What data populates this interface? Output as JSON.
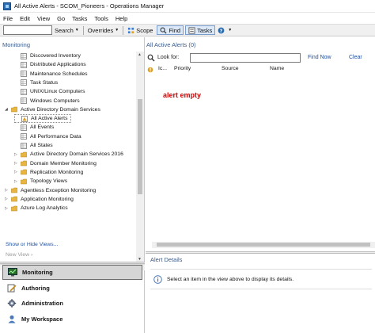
{
  "window": {
    "title": "All Active Alerts - SCOM_Pioneers - Operations Manager"
  },
  "menu": [
    "File",
    "Edit",
    "View",
    "Go",
    "Tasks",
    "Tools",
    "Help"
  ],
  "toolbar": {
    "search_label": "Search",
    "search_value": "",
    "overrides_label": "Overrides",
    "scope_label": "Scope",
    "find_label": "Find",
    "tasks_label": "Tasks"
  },
  "left": {
    "header": "Monitoring",
    "tree": [
      {
        "label": "Discovered Inventory",
        "level": 1,
        "icon": "grid"
      },
      {
        "label": "Distributed Applications",
        "level": 1,
        "icon": "grid"
      },
      {
        "label": "Maintenance Schedules",
        "level": 1,
        "icon": "grid"
      },
      {
        "label": "Task Status",
        "level": 1,
        "icon": "grid"
      },
      {
        "label": "UNIX/Linux Computers",
        "level": 1,
        "icon": "grid"
      },
      {
        "label": "Windows Computers",
        "level": 1,
        "icon": "grid"
      },
      {
        "label": "Active Directory Domain Services",
        "level": 0,
        "icon": "folder",
        "expanded": true
      },
      {
        "label": "All Active Alerts",
        "level": 1,
        "icon": "alert",
        "selected": true
      },
      {
        "label": "All Events",
        "level": 1,
        "icon": "grid"
      },
      {
        "label": "All Performance Data",
        "level": 1,
        "icon": "grid"
      },
      {
        "label": "All States",
        "level": 1,
        "icon": "grid"
      },
      {
        "label": "Active Directory Domain Services 2016",
        "level": 1,
        "icon": "folder",
        "expanded": false
      },
      {
        "label": "Domain Member Monitoring",
        "level": 1,
        "icon": "folder",
        "expanded": false
      },
      {
        "label": "Replication Monitoring",
        "level": 1,
        "icon": "folder",
        "expanded": false
      },
      {
        "label": "Topology Views",
        "level": 1,
        "icon": "folder",
        "expanded": false
      },
      {
        "label": "Agentless Exception Monitoring",
        "level": 0,
        "icon": "folder",
        "expanded": false
      },
      {
        "label": "Application Monitoring",
        "level": 0,
        "icon": "folder",
        "expanded": false
      },
      {
        "label": "Azure Log Analytics",
        "level": 0,
        "icon": "folder",
        "expanded": false
      }
    ],
    "show_hide_views": "Show or Hide Views...",
    "new_view": "New View ›",
    "workspaces": [
      {
        "label": "Monitoring",
        "icon": "monitor-icon",
        "active": true
      },
      {
        "label": "Authoring",
        "icon": "authoring-icon",
        "active": false
      },
      {
        "label": "Administration",
        "icon": "gear-icon",
        "active": false
      },
      {
        "label": "My Workspace",
        "icon": "user-icon",
        "active": false
      }
    ]
  },
  "right": {
    "header": "All Active Alerts (0)",
    "look_for_label": "Look for:",
    "look_for_value": "",
    "find_now": "Find Now",
    "clear": "Clear",
    "columns": [
      "Ic...",
      "Priority",
      "Source",
      "Name"
    ],
    "empty_note": "alert empty",
    "details_title": "Alert Details",
    "details_text": "Select an item in the view above to display its details."
  },
  "colors": {
    "header_blue": "#3a5a8a",
    "folder": "#e8b640",
    "annotation_red": "#d60000"
  }
}
